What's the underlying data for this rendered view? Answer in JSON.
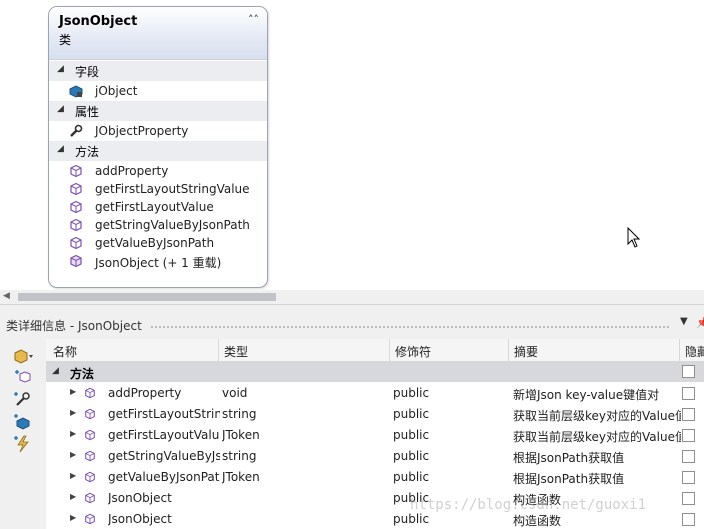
{
  "class_box": {
    "name": "JsonObject",
    "kind": "类",
    "sections": [
      {
        "title": "字段",
        "members": [
          {
            "label": "jObject",
            "icon": "field-icon"
          }
        ]
      },
      {
        "title": "属性",
        "members": [
          {
            "label": "JObjectProperty",
            "icon": "wrench-property-icon"
          }
        ]
      },
      {
        "title": "方法",
        "members": [
          {
            "label": "addProperty",
            "icon": "method-cube-icon"
          },
          {
            "label": "getFirstLayoutStringValue",
            "icon": "method-cube-icon"
          },
          {
            "label": "getFirstLayoutValue",
            "icon": "method-cube-icon"
          },
          {
            "label": "getStringValueByJsonPath",
            "icon": "method-cube-icon"
          },
          {
            "label": "getValueByJsonPath",
            "icon": "method-cube-icon"
          },
          {
            "label": "JsonObject (+ 1 重载)",
            "icon": "constructor-cube-icon"
          }
        ]
      }
    ]
  },
  "details_panel": {
    "title": "类详细信息 - JsonObject",
    "columns": {
      "name": "名称",
      "type": "类型",
      "modifier": "修饰符",
      "summary": "摘要",
      "hidden": "隐藏"
    },
    "group": "方法",
    "rows": [
      {
        "name": "addProperty",
        "type": "void",
        "modifier": "public",
        "summary": "新增Json key-value键值对"
      },
      {
        "name": "getFirstLayoutStringValue",
        "type": "string",
        "modifier": "public",
        "summary": "获取当前层级key对应的Value值"
      },
      {
        "name": "getFirstLayoutValue",
        "type": "JToken",
        "modifier": "public",
        "summary": "获取当前层级key对应的Value值"
      },
      {
        "name": "getStringValueByJsonPath",
        "type": "string",
        "modifier": "public",
        "summary": "根据JsonPath获取值"
      },
      {
        "name": "getValueByJsonPath",
        "type": "JToken",
        "modifier": "public",
        "summary": "根据JsonPath获取值"
      },
      {
        "name": "JsonObject",
        "type": "",
        "modifier": "public",
        "summary": "构造函数"
      },
      {
        "name": "JsonObject",
        "type": "",
        "modifier": "public",
        "summary": "构造函数"
      }
    ]
  },
  "watermark": "https://blog.csdn.net/guoxi1",
  "colors": {
    "accent_method": "#7b4fb3",
    "accent_field": "#2a7ab8",
    "group_bg": "#d6d8dc"
  }
}
